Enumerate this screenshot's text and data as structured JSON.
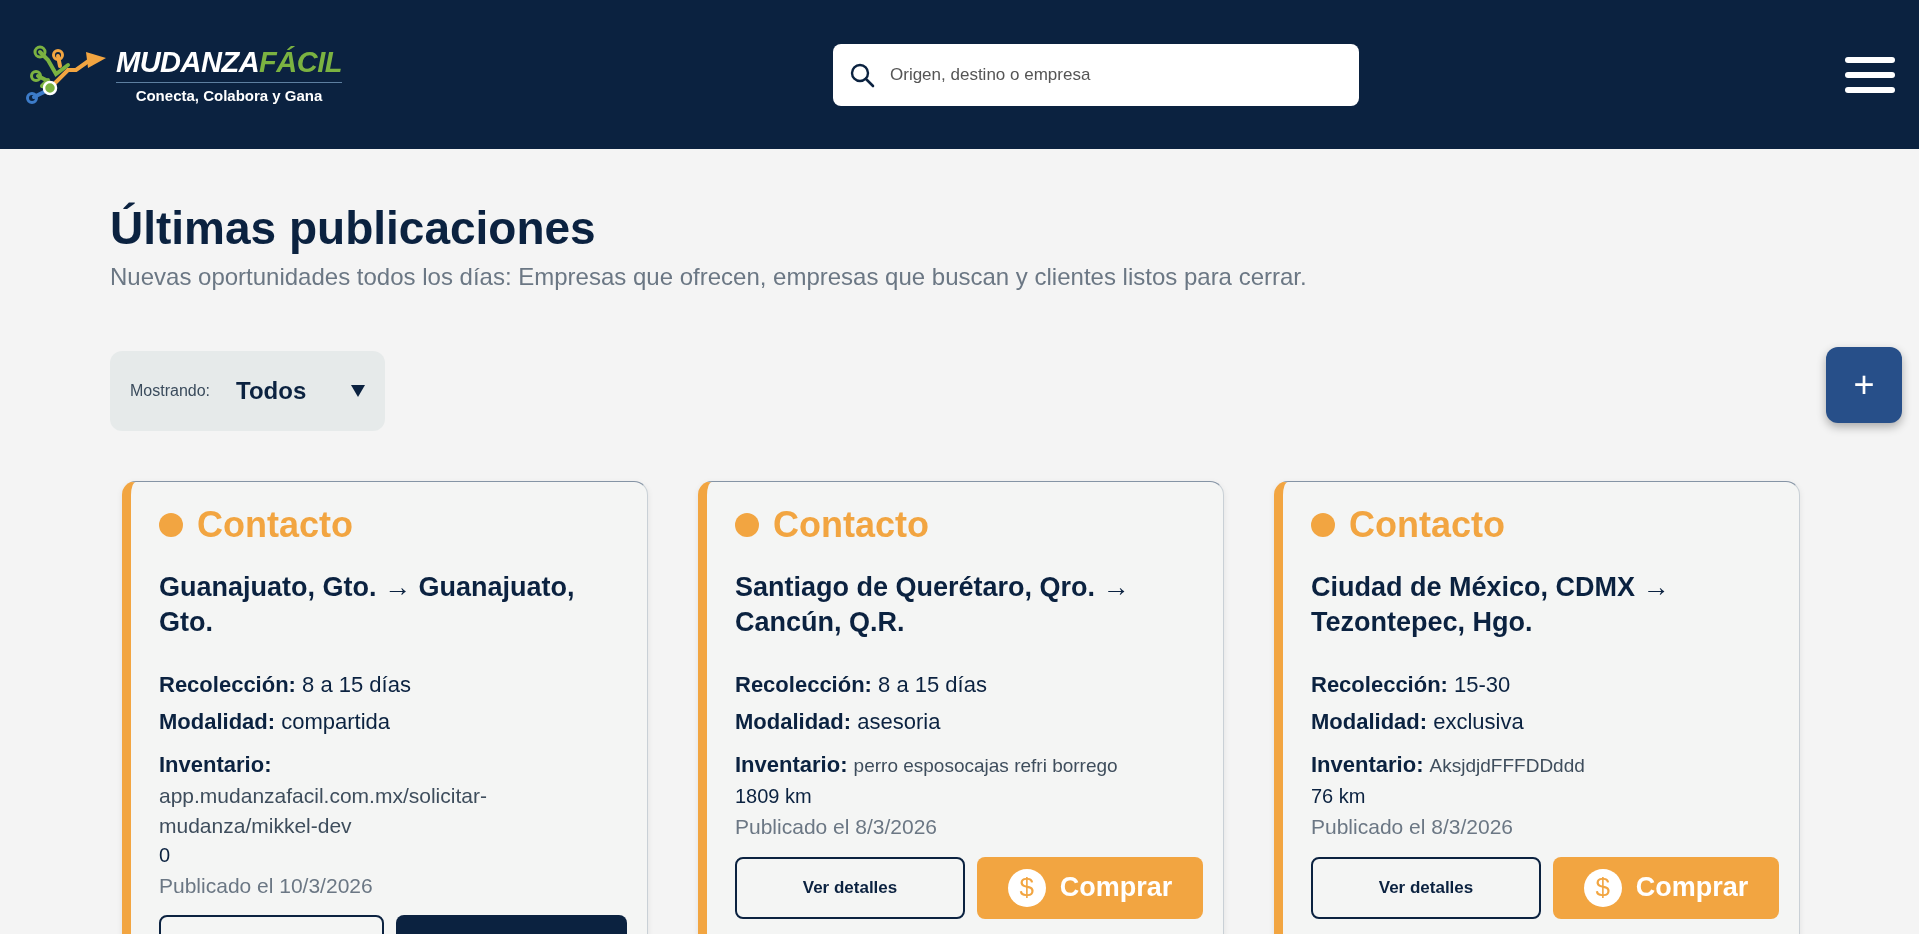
{
  "header": {
    "logo": {
      "brand_main": "MUDANZA",
      "brand_accent": "FÁCIL",
      "tagline": "Conecta, Colabora y Gana"
    },
    "search": {
      "placeholder": "Origen, destino o empresa"
    }
  },
  "page": {
    "title": "Últimas publicaciones",
    "subtitle": "Nuevas oportunidades todos los días: Empresas que ofrecen, empresas que buscan y clientes listos para cerrar."
  },
  "filter": {
    "label": "Mostrando:",
    "value": "Todos"
  },
  "add_button": {
    "label": "+"
  },
  "cards": [
    {
      "status": "Contacto",
      "color": "#f2a541",
      "route": "Guanajuato, Gto. → Guanajuato, Gto.",
      "pickup_label": "Recolección:",
      "pickup": "8 a 15 días",
      "mode_label": "Modalidad:",
      "mode": "compartida",
      "inventory_label": "Inventario:",
      "inventory": "app.mudanzafacil.com.mx/solicitar-mudanza/mikkel-dev",
      "inventory_block": true,
      "distance": "0",
      "published": "Publicado el 10/3/2026",
      "buttons": [
        {
          "kind": "outline"
        },
        {
          "kind": "dark"
        }
      ]
    },
    {
      "status": "Contacto",
      "color": "#f2a541",
      "route": "Santiago de Querétaro, Qro. → Cancún, Q.R.",
      "pickup_label": "Recolección:",
      "pickup": "8 a 15 días",
      "mode_label": "Modalidad:",
      "mode": "asesoria",
      "inventory_label": "Inventario:",
      "inventory": "perro esposocajas refri borrego",
      "inventory_block": false,
      "distance": "1809 km",
      "published": "Publicado el 8/3/2026",
      "buttons": [
        {
          "kind": "outline",
          "label": "Ver detalles"
        },
        {
          "kind": "buy",
          "label": "Comprar",
          "icon": "$"
        }
      ]
    },
    {
      "status": "Contacto",
      "color": "#f2a541",
      "route": "Ciudad de México, CDMX → Tezontepec, Hgo.",
      "pickup_label": "Recolección:",
      "pickup": "15-30",
      "mode_label": "Modalidad:",
      "mode": "exclusiva",
      "inventory_label": "Inventario:",
      "inventory": "AksjdjdFFFDDddd",
      "inventory_block": false,
      "distance": "76 km",
      "published": "Publicado el 8/3/2026",
      "buttons": [
        {
          "kind": "outline",
          "label": "Ver detalles"
        },
        {
          "kind": "buy",
          "label": "Comprar",
          "icon": "$"
        }
      ]
    }
  ]
}
